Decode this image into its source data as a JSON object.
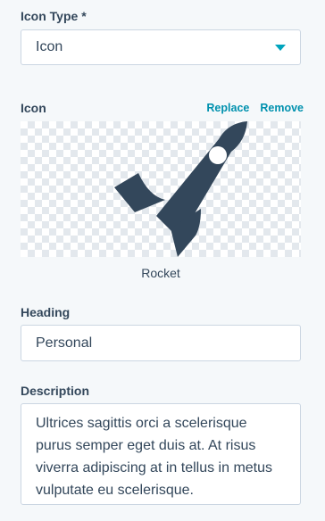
{
  "icon_type": {
    "label": "Icon Type *",
    "selected": "Icon"
  },
  "icon": {
    "label": "Icon",
    "replace_label": "Replace",
    "remove_label": "Remove",
    "preview_icon": "rocket-icon",
    "name": "Rocket",
    "color": "#33475b"
  },
  "heading": {
    "label": "Heading",
    "value": "Personal"
  },
  "description": {
    "label": "Description",
    "value": "Ultrices sagittis orci a scelerisque purus semper eget duis at. At risus viverra adipiscing at in tellus in metus vulputate eu scelerisque."
  },
  "colors": {
    "accent": "#00a4bd",
    "link": "#0091ae",
    "text": "#33475b",
    "border": "#cbd6e2"
  }
}
